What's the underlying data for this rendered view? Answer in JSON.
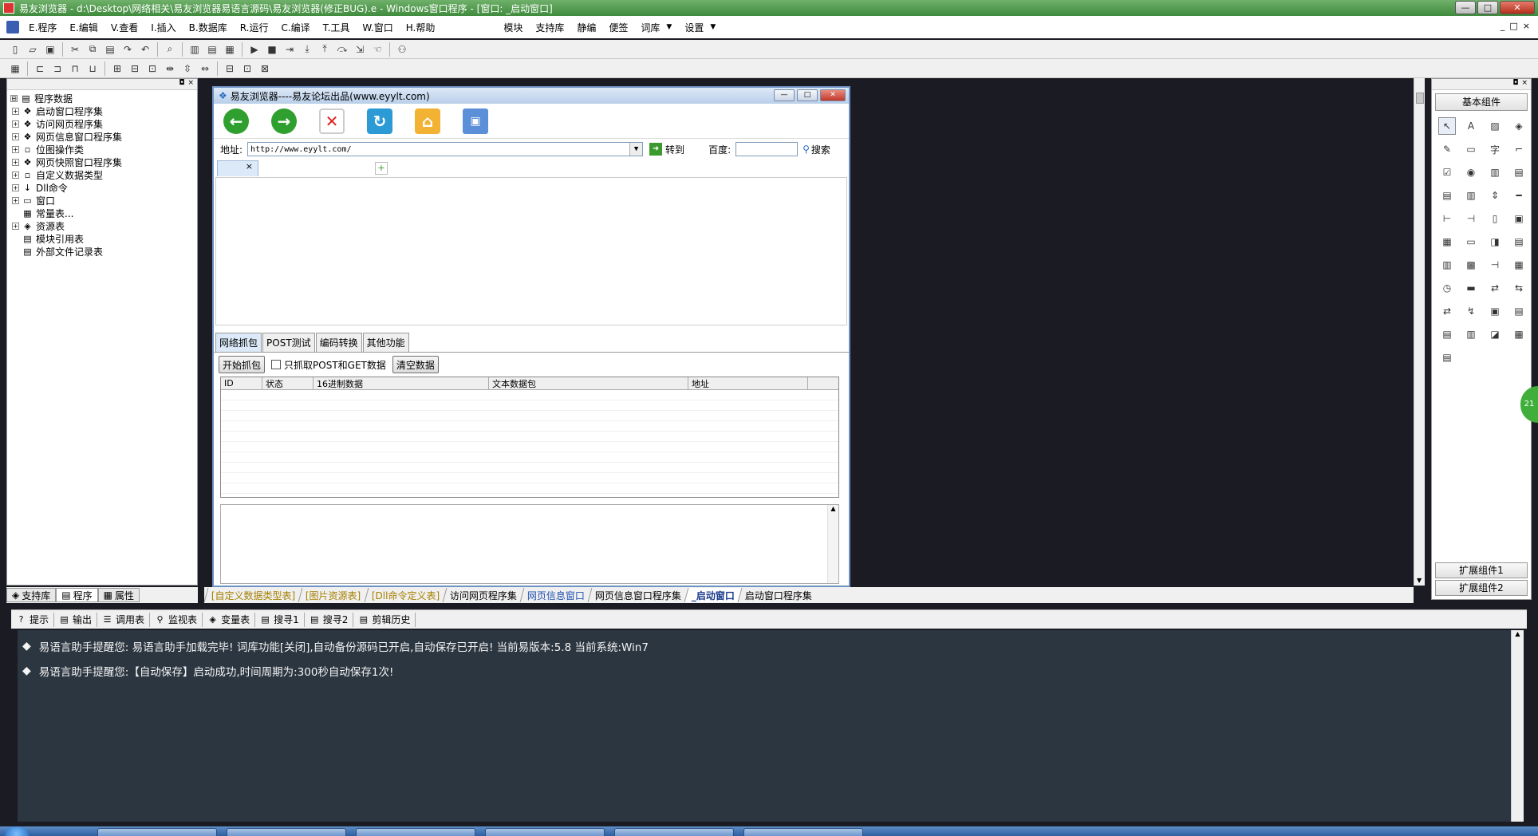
{
  "titlebar": {
    "title": "易友浏览器 - d:\\Desktop\\网络相关\\易友浏览器易语言源码\\易友浏览器(修正BUG).e - Windows窗口程序 - [窗口: _启动窗口]",
    "btn_min": "—",
    "btn_max": "□",
    "btn_close": "✕"
  },
  "menubar": {
    "items": [
      "E.程序",
      "E.编辑",
      "V.查看",
      "I.插入",
      "B.数据库",
      "R.运行",
      "C.编译",
      "T.工具",
      "W.窗口",
      "H.帮助"
    ],
    "extra": [
      "模块",
      "支持库",
      "静编",
      "便签",
      "词库",
      "设置"
    ],
    "right_btns": [
      "_",
      "□",
      "×"
    ]
  },
  "left_panel": {
    "header_btns": [
      "◘",
      "×"
    ],
    "tree": [
      {
        "label": "程序数据",
        "expander": "⊟",
        "icon": "▤",
        "indent": 0
      },
      {
        "label": "启动窗口程序集",
        "expander": "+",
        "icon": "❖",
        "indent": 1
      },
      {
        "label": "访问网页程序集",
        "expander": "+",
        "icon": "❖",
        "indent": 1
      },
      {
        "label": "网页信息窗口程序集",
        "expander": "+",
        "icon": "❖",
        "indent": 1
      },
      {
        "label": "位图操作类",
        "expander": "+",
        "icon": "▫",
        "indent": 1
      },
      {
        "label": "网页快照窗口程序集",
        "expander": "+",
        "icon": "❖",
        "indent": 1
      },
      {
        "label": "自定义数据类型",
        "expander": "+",
        "icon": "▫",
        "indent": 1
      },
      {
        "label": "Dll命令",
        "expander": "+",
        "icon": "↓",
        "indent": 1
      },
      {
        "label": "窗口",
        "expander": "+",
        "icon": "▭",
        "indent": 1
      },
      {
        "label": "常量表...",
        "expander": "",
        "icon": "▦",
        "indent": 1
      },
      {
        "label": "资源表",
        "expander": "+",
        "icon": "◈",
        "indent": 1
      },
      {
        "label": "模块引用表",
        "expander": "",
        "icon": "▤",
        "indent": 1
      },
      {
        "label": "外部文件记录表",
        "expander": "",
        "icon": "▤",
        "indent": 1
      }
    ],
    "tabs": [
      "支持库",
      "程序",
      "属性"
    ]
  },
  "design_window": {
    "title": "易友浏览器----易友论坛出品(www.eyylt.com)",
    "address_label": "地址:",
    "address_value": "http://www.eyylt.com/",
    "go_label": "转到",
    "baidu_label": "百度:",
    "baidu_value": "",
    "search_label": "搜索",
    "tab_close": "×",
    "new_tab": "+",
    "lower_tabs": [
      "网络抓包",
      "POST测试",
      "编码转换",
      "其他功能"
    ],
    "start_capture": "开始抓包",
    "only_post_get": "只抓取POST和GET数据",
    "clear_data": "清空数据",
    "grid_columns": [
      "ID",
      "状态",
      "16进制数据",
      "文本数据包",
      "地址"
    ]
  },
  "right_panel": {
    "header_btns": [
      "◘",
      "×"
    ],
    "title": "基本组件",
    "components": [
      "↖",
      "A",
      "▨",
      "◈",
      "✎",
      "▭",
      "字",
      "⌐",
      "☑",
      "◉",
      "▥",
      "▤",
      "▤",
      "▥",
      "⇕",
      "━",
      "⊢",
      "⊣",
      "▯",
      "▣",
      "▦",
      "▭",
      "◨",
      "▤",
      "▥",
      "▩",
      "⊣",
      "▦",
      "◷",
      "▬",
      "⇄",
      "⇆",
      "⇄",
      "↯",
      "▣",
      "▤",
      "▤",
      "▥",
      "◪",
      "▦",
      "▤"
    ],
    "ext1": "扩展组件1",
    "ext2": "扩展组件2"
  },
  "file_tabs": [
    {
      "label": "[自定义数据类型表]",
      "style": "gold"
    },
    {
      "label": "[图片资源表]",
      "style": "gold"
    },
    {
      "label": "[Dll命令定义表]",
      "style": "gold"
    },
    {
      "label": "访问网页程序集",
      "style": "normal"
    },
    {
      "label": "网页信息窗口",
      "style": "blue"
    },
    {
      "label": "网页信息窗口程序集",
      "style": "normal"
    },
    {
      "label": "_启动窗口",
      "style": "active"
    },
    {
      "label": "启动窗口程序集",
      "style": "normal"
    }
  ],
  "output_tabs": [
    {
      "label": "提示",
      "icon": "?"
    },
    {
      "label": "输出",
      "icon": "▤"
    },
    {
      "label": "调用表",
      "icon": "☰"
    },
    {
      "label": "监视表",
      "icon": "⚲"
    },
    {
      "label": "变量表",
      "icon": "◈"
    },
    {
      "label": "搜寻1",
      "icon": "▤"
    },
    {
      "label": "搜寻2",
      "icon": "▤"
    },
    {
      "label": "剪辑历史",
      "icon": "▤"
    }
  ],
  "output": {
    "lines": [
      "易语言助手提醒您:  易语言助手加载完毕!  词库功能[关闭],自动备份源码已开启,自动保存已开启!  当前易版本:5.8  当前系统:Win7",
      "易语言助手提醒您:【自动保存】启动成功,时间周期为:300秒自动保存1次!"
    ],
    "bullet": "◆"
  },
  "side_widget": "21",
  "colors": {
    "titlebar": "#4a9a48",
    "output_bg": "#2c3641",
    "workspace_bg": "#1b1b23"
  }
}
